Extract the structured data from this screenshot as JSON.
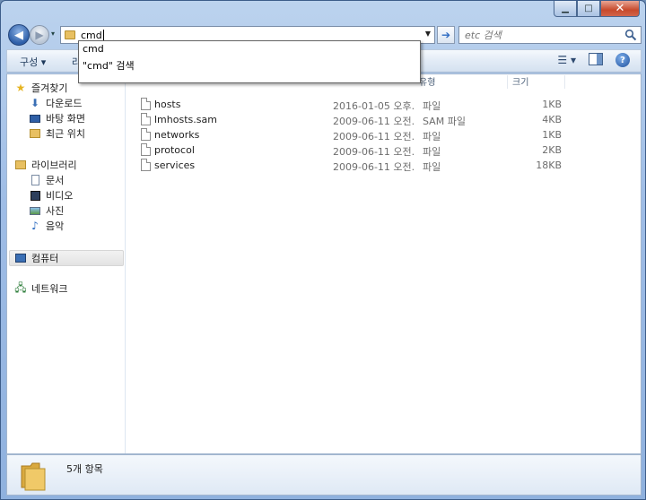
{
  "window": {
    "controls": {
      "minimize": "▁",
      "maximize": "□",
      "close": "✕"
    }
  },
  "navigation": {
    "address_value": "cmd",
    "search_placeholder": "etc 검색"
  },
  "autocomplete": {
    "items": [
      "cmd",
      "\"cmd\" 검색"
    ]
  },
  "commandbar": {
    "organize_label": "구성 ▾",
    "second_label": "라"
  },
  "sidebar": {
    "favorites_label": "즐겨찾기",
    "favorites": [
      "다운로드",
      "바탕 화면",
      "최근 위치"
    ],
    "libraries_label": "라이브러리",
    "libraries": [
      "문서",
      "비디오",
      "사진",
      "음악"
    ],
    "computer_label": "컴퓨터",
    "network_label": "네트워크"
  },
  "columns": {
    "type": "유형",
    "size": "크기"
  },
  "files": [
    {
      "name": "hosts",
      "date": "2016-01-05 오후...",
      "type": "파일",
      "size": "1KB"
    },
    {
      "name": "lmhosts.sam",
      "date": "2009-06-11 오전...",
      "type": "SAM 파일",
      "size": "4KB"
    },
    {
      "name": "networks",
      "date": "2009-06-11 오전...",
      "type": "파일",
      "size": "1KB"
    },
    {
      "name": "protocol",
      "date": "2009-06-11 오전...",
      "type": "파일",
      "size": "2KB"
    },
    {
      "name": "services",
      "date": "2009-06-11 오전...",
      "type": "파일",
      "size": "18KB"
    }
  ],
  "details": {
    "item_count": "5개 항목"
  },
  "colors": {
    "accent": "#2e5fa8",
    "close_red": "#c74a2c",
    "folder_yellow": "#e8c062"
  }
}
